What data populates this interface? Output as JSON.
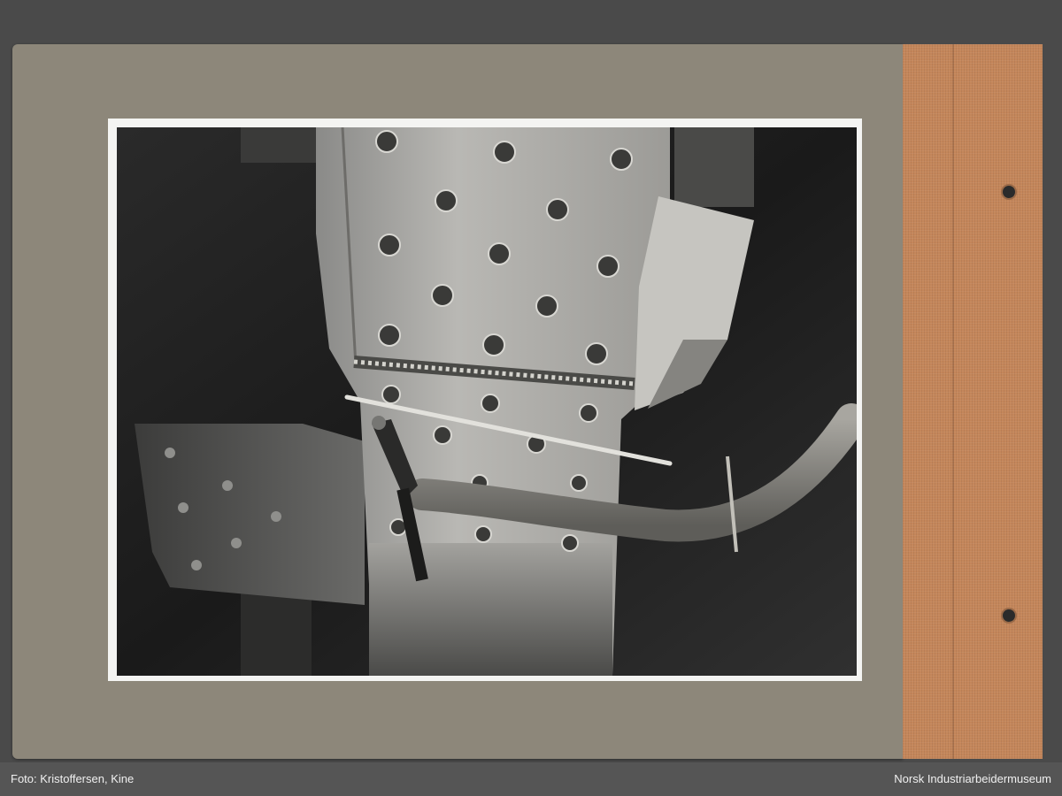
{
  "photo_credit": "Foto: Kristoffersen, Kine",
  "institution": "Norsk Industriarbeidermuseum",
  "photo": {
    "subject": "black-and-white photograph of a riveted steel beam joint with a weld seam and a welding torch with wrapped hose"
  },
  "colors": {
    "background": "#4a4a4a",
    "board": "#8d877a",
    "spine": "#c4865a",
    "footer": "#555555"
  }
}
